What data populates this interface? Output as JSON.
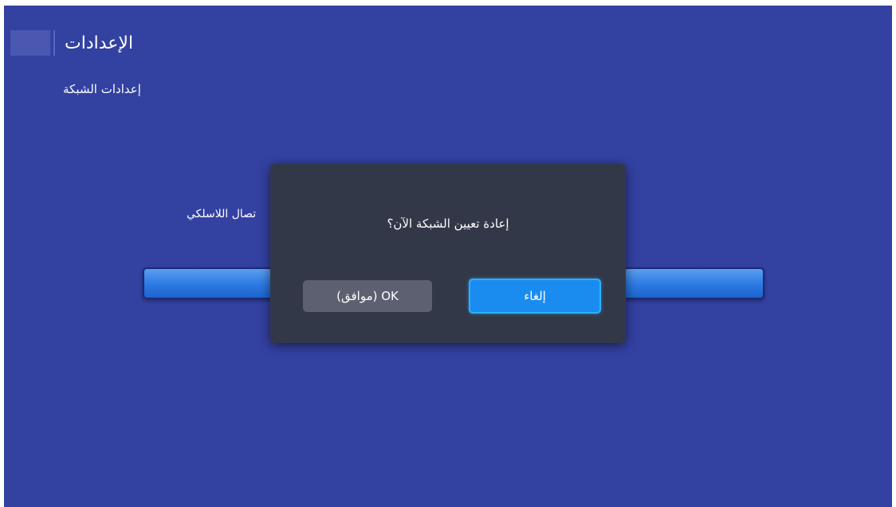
{
  "header": {
    "title": "الإعدادات"
  },
  "subtitle": "إعدادات الشبكة",
  "background_item": {
    "label": "تصال اللاسلكي"
  },
  "dialog": {
    "message": "إعادة تعيين الشبكة الآن؟",
    "ok_label": "OK (موافق)",
    "cancel_label": "إلغاء"
  },
  "colors": {
    "background": "#3341a1",
    "dialog_bg": "#333849",
    "ok_button": "#5d6070",
    "cancel_button": "#1a8cf0",
    "focus_border": "#2fb0ff"
  }
}
